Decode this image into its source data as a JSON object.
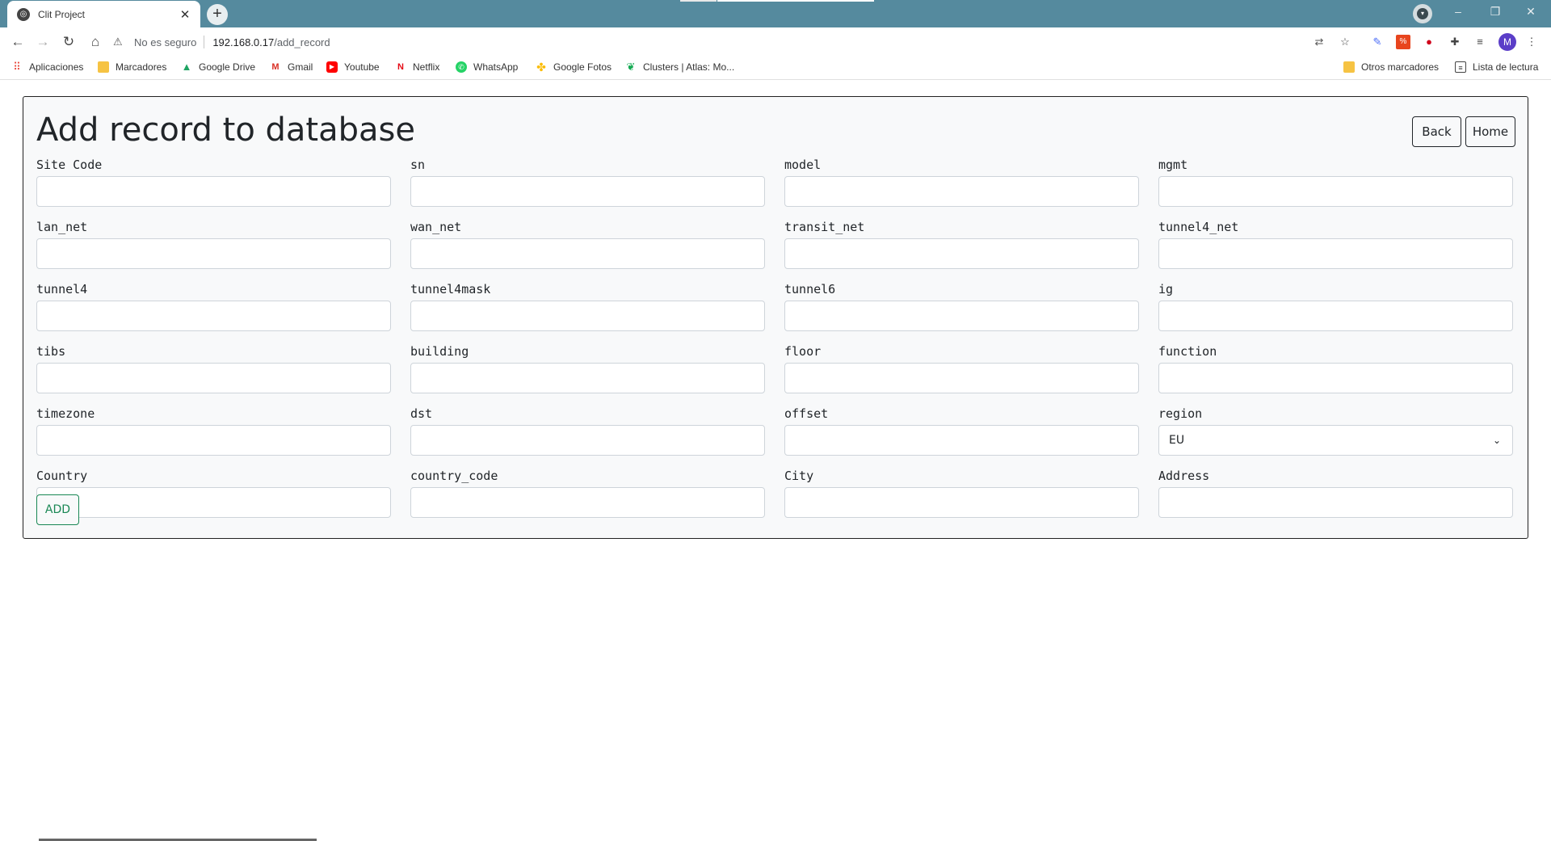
{
  "browser": {
    "tab_title": "Clit Project",
    "tab_close": "✕",
    "new_tab": "+",
    "security_label": "No es seguro",
    "url_host": "192.168.0.17",
    "url_path": "/add_record",
    "avatar_letter": "M",
    "window_controls": [
      "–",
      "❐",
      "✕"
    ]
  },
  "bookmarks": [
    {
      "label": "Aplicaciones",
      "icon": "apps-grid-icon",
      "color": "#e94235"
    },
    {
      "label": "Marcadores",
      "icon": "folder-icon",
      "color": "#f6c343"
    },
    {
      "label": "Google Drive",
      "icon": "google-drive-icon",
      "color": "#1fa463"
    },
    {
      "label": "Gmail",
      "icon": "gmail-icon",
      "color": "#d93025"
    },
    {
      "label": "Youtube",
      "icon": "youtube-icon",
      "color": "#ff0000"
    },
    {
      "label": "Netflix",
      "icon": "netflix-icon",
      "color": "#e50914"
    },
    {
      "label": "WhatsApp",
      "icon": "whatsapp-icon",
      "color": "#25d366"
    },
    {
      "label": "Google Fotos",
      "icon": "google-photos-icon",
      "color": "#fbbc04"
    },
    {
      "label": "Clusters | Atlas: Mo...",
      "icon": "mongodb-leaf-icon",
      "color": "#13aa52"
    },
    {
      "label": "Otros marcadores",
      "icon": "folder-icon",
      "color": "#f6c343"
    },
    {
      "label": "Lista de lectura",
      "icon": "reading-list-icon",
      "color": "#444444"
    }
  ],
  "page": {
    "title": "Add record to database",
    "back_label": "Back",
    "home_label": "Home",
    "add_label": "ADD"
  },
  "fields": [
    {
      "label": "Site Code",
      "value": ""
    },
    {
      "label": "sn",
      "value": ""
    },
    {
      "label": "model",
      "value": ""
    },
    {
      "label": "mgmt",
      "value": ""
    },
    {
      "label": "lan_net",
      "value": ""
    },
    {
      "label": "wan_net",
      "value": ""
    },
    {
      "label": "transit_net",
      "value": ""
    },
    {
      "label": "tunnel4_net",
      "value": ""
    },
    {
      "label": "tunnel4",
      "value": ""
    },
    {
      "label": "tunnel4mask",
      "value": ""
    },
    {
      "label": "tunnel6",
      "value": ""
    },
    {
      "label": "ig",
      "value": ""
    },
    {
      "label": "tibs",
      "value": ""
    },
    {
      "label": "building",
      "value": ""
    },
    {
      "label": "floor",
      "value": ""
    },
    {
      "label": "function",
      "value": ""
    },
    {
      "label": "timezone",
      "value": ""
    },
    {
      "label": "dst",
      "value": ""
    },
    {
      "label": "offset",
      "value": ""
    },
    {
      "label": "region",
      "value": "EU",
      "type": "select"
    },
    {
      "label": "Country",
      "value": ""
    },
    {
      "label": "country_code",
      "value": ""
    },
    {
      "label": "City",
      "value": ""
    },
    {
      "label": "Address",
      "value": ""
    }
  ]
}
